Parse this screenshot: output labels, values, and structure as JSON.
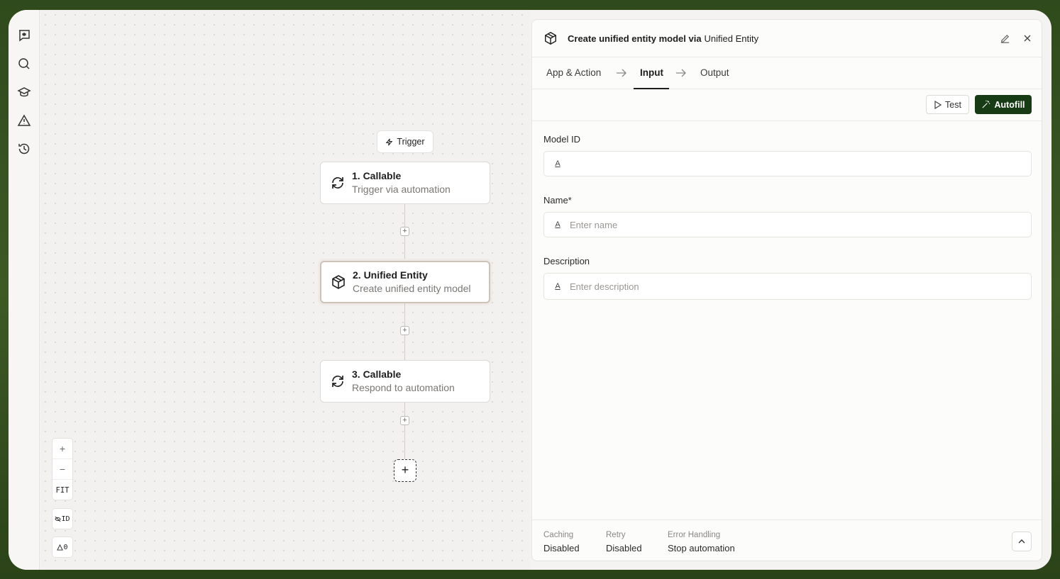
{
  "rail": {
    "icons": [
      "agent-icon",
      "search-icon",
      "learn-icon",
      "alert-icon",
      "history-icon"
    ]
  },
  "canvas": {
    "trigger_label": "Trigger",
    "nodes": [
      {
        "title": "1. Callable",
        "subtitle": "Trigger via automation",
        "icon": "refresh-icon"
      },
      {
        "title": "2. Unified Entity",
        "subtitle": "Create unified entity model",
        "icon": "cube-icon"
      },
      {
        "title": "3. Callable",
        "subtitle": "Respond to automation",
        "icon": "refresh-icon"
      }
    ],
    "zoom": {
      "in": "+",
      "out": "−",
      "fit": "FIT"
    },
    "id_toggle": "ID",
    "warnings_count": "0"
  },
  "panel": {
    "title_bold": "Create unified entity model via",
    "title_app": "Unified Entity",
    "tabs": [
      "App & Action",
      "Input",
      "Output"
    ],
    "active_tab": "Input",
    "test_label": "Test",
    "autofill_label": "Autofill",
    "fields": [
      {
        "label": "Model ID",
        "value": "",
        "placeholder": ""
      },
      {
        "label": "Name*",
        "value": "",
        "placeholder": "Enter name"
      },
      {
        "label": "Description",
        "value": "",
        "placeholder": "Enter description"
      }
    ],
    "footer": {
      "caching_label": "Caching",
      "caching_value": "Disabled",
      "retry_label": "Retry",
      "retry_value": "Disabled",
      "error_label": "Error Handling",
      "error_value": "Stop automation"
    }
  },
  "colors": {
    "accent": "#173b14",
    "background": "#f4f3f1",
    "border": "#e6e4e0"
  }
}
